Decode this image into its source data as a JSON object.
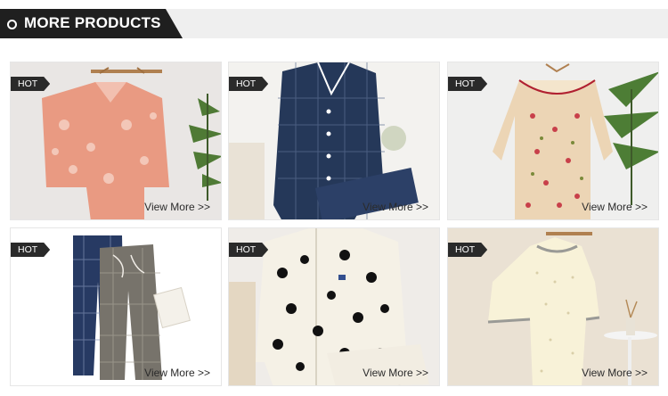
{
  "header": {
    "title": "MORE PRODUCTS"
  },
  "products": [
    {
      "badge": "HOT",
      "link": "View More >>",
      "image": "peach floral pajama set"
    },
    {
      "badge": "HOT",
      "link": "View More >>",
      "image": "navy plaid pajama set"
    },
    {
      "badge": "HOT",
      "link": "View More >>",
      "image": "floral nightdress with ruffle collar"
    },
    {
      "badge": "HOT",
      "link": "View More >>",
      "image": "plaid lounge pants"
    },
    {
      "badge": "HOT",
      "link": "View More >>",
      "image": "cream fleece pajama with black dots"
    },
    {
      "badge": "HOT",
      "link": "View More >>",
      "image": "cream pajama set with grey trim"
    }
  ],
  "colors": {
    "header_dark": "#1f1f1f",
    "header_light": "#efefef",
    "badge": "#2a2a2a"
  }
}
